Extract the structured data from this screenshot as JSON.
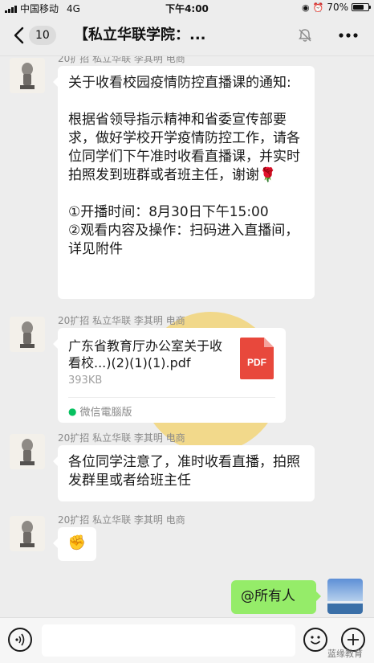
{
  "status_bar": {
    "carrier": "中国移动",
    "network": "4G",
    "time": "下午4:00",
    "battery": "70%"
  },
  "nav": {
    "back_count": "10",
    "title": "【私立华联学院：...",
    "icons": [
      "back-icon",
      "mute-icon",
      "more-icon"
    ]
  },
  "messages": [
    {
      "sender": "20扩招  私立华联  李其明  电商",
      "lines": [
        "关于收看校园疫情防控直播课的通知:",
        "",
        "根据省领导指示精神和省委宣传部要求，做好学校开学疫情防控工作，请各位同学们下午准时收看直播课，并实时拍照发到班群或者班主任，谢谢🌹",
        "",
        "①开播时间：8月30日下午15:00",
        "②观看内容及操作：扫码进入直播间，详见附件"
      ]
    },
    {
      "sender": "20扩招  私立华联  李其明  电商",
      "file": {
        "name": "广东省教育厅办公室关于收看校...)(2)(1)(1).pdf",
        "size": "393KB",
        "type_label": "PDF",
        "source": "微信電腦版"
      }
    },
    {
      "sender": "20扩招  私立华联  李其明  电商",
      "text": "各位同学注意了，准时收看直播，拍照发群里或者给班主任"
    },
    {
      "sender": "20扩招  私立华联  李其明  电商",
      "text": "✊"
    },
    {
      "self": true,
      "text": "@所有人"
    }
  ],
  "watermark": "蓝缘教育",
  "colors": {
    "background": "#ededed",
    "bubble_self": "#95ec69",
    "bubble_other": "#ffffff",
    "pdf_red": "#e8483c"
  }
}
